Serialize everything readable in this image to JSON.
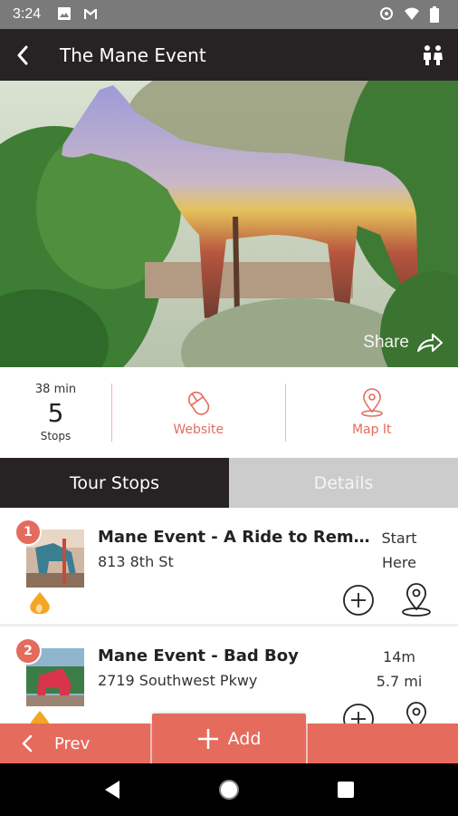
{
  "status_bar": {
    "time": "3:24"
  },
  "app_bar": {
    "title": "The Mane Event"
  },
  "hero": {
    "share_label": "Share"
  },
  "stats": {
    "duration": "38 min",
    "stop_count": "5",
    "stops_label": "Stops",
    "website_label": "Website",
    "map_label": "Map It"
  },
  "tabs": [
    {
      "label": "Tour Stops",
      "active": true
    },
    {
      "label": "Details",
      "active": false
    }
  ],
  "stops": [
    {
      "number": "1",
      "title": "Mane Event - A Ride to Reme...",
      "address": "813 8th St",
      "meta_line1": "Start",
      "meta_line2": "Here"
    },
    {
      "number": "2",
      "title": "Mane Event - Bad Boy",
      "address": "2719 Southwest Pkwy",
      "meta_line1": "14m",
      "meta_line2": "5.7 mi"
    }
  ],
  "action_bar": {
    "prev_label": "Prev",
    "add_label": "Add"
  },
  "colors": {
    "accent": "#e56b5d",
    "dark": "#272324",
    "tab_inactive": "#cccccc"
  }
}
